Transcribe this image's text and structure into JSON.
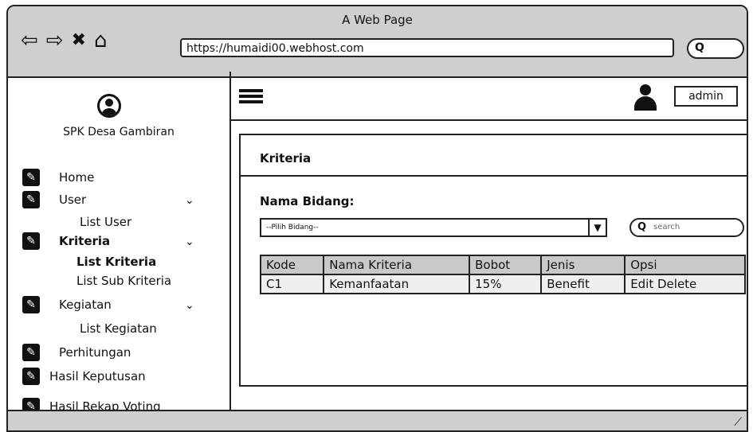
{
  "window": {
    "title": "A Web Page",
    "url": "https://humaidi00.webhost.com"
  },
  "nav": {
    "back": "⇦",
    "forward": "⇨",
    "close": "✖",
    "home": "⌂"
  },
  "sidebar": {
    "app_name": "SPK Desa Gambiran",
    "items": [
      {
        "label": "Home"
      },
      {
        "label": "User",
        "sub": [
          "List User"
        ]
      },
      {
        "label": "Kriteria",
        "sub": [
          "List Kriteria",
          "List Sub Kriteria"
        ]
      },
      {
        "label": "Kegiatan",
        "sub": [
          "List Kegiatan"
        ]
      },
      {
        "label": "Perhitungan"
      },
      {
        "label": "Hasil Keputusan"
      },
      {
        "label": "Hasil Rekap Voting"
      }
    ]
  },
  "topbar": {
    "user": "admin"
  },
  "panel": {
    "title": "Kriteria",
    "field_label": "Nama Bidang:",
    "select_value": "--Pilih Bidang--",
    "search_placeholder": "search",
    "columns": [
      "Kode",
      "Nama Kriteria",
      "Bobot",
      "Jenis",
      "Opsi"
    ],
    "rows": [
      [
        "C1",
        "Kemanfaatan",
        "15%",
        "Benefit",
        "Edit Delete"
      ]
    ]
  }
}
